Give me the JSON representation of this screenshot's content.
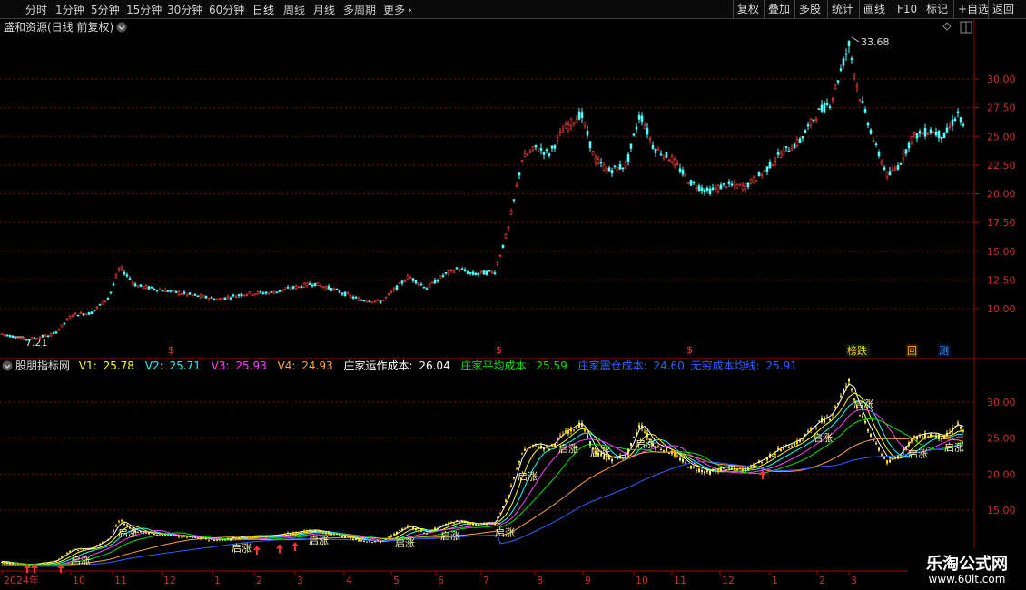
{
  "toolbar": {
    "periods": [
      "分时",
      "1分钟",
      "5分钟",
      "15分钟",
      "30分钟",
      "60分钟",
      "日线",
      "周线",
      "月线",
      "多周期",
      "更多"
    ],
    "active_period": "日线",
    "right_items": [
      "复权",
      "叠加",
      "多股",
      "统计",
      "画线",
      "F10",
      "标记",
      "+自选",
      "返回"
    ]
  },
  "main_panel": {
    "title": "盛和资源(日线 前复权)",
    "high_label": "33.68",
    "low_label": "7.21",
    "y_ticks": [
      "30.00",
      "27.50",
      "25.00",
      "22.50",
      "20.00",
      "17.50",
      "15.00",
      "12.50",
      "10.00"
    ],
    "tags": [
      "榜跌",
      "回",
      "测"
    ],
    "markers": [
      "$",
      "$",
      "$"
    ]
  },
  "indicator_panel": {
    "name": "股朋指标网",
    "fields": [
      {
        "label": "V1:",
        "value": "25.78",
        "color": "#ffff00"
      },
      {
        "label": "V2:",
        "value": "25.71",
        "color": "#00ffff"
      },
      {
        "label": "V3:",
        "value": "25.93",
        "color": "#ff40ff"
      },
      {
        "label": "V4:",
        "value": "24.93",
        "color": "#ffa040"
      },
      {
        "label": "庄家运作成本:",
        "value": "26.04",
        "color": "#ffffff"
      },
      {
        "label": "庄家平均成本:",
        "value": "25.59",
        "color": "#00e000"
      },
      {
        "label": "庄家震仓成本:",
        "value": "24.60",
        "color": "#3060ff"
      },
      {
        "label": "无穷成本均线:",
        "value": "25.91",
        "color": "#3060ff"
      }
    ],
    "y_ticks": [
      "30.00",
      "25.00",
      "20.00",
      "15.00"
    ],
    "signal_text": "启涨"
  },
  "x_axis": {
    "labels": [
      "2024年",
      "10",
      "11",
      "12",
      "1",
      "2",
      "3",
      "4",
      "5",
      "6",
      "7",
      "8",
      "9",
      "10",
      "11",
      "12",
      "1",
      "2",
      "3"
    ]
  },
  "watermark": {
    "line1": "乐淘公式网",
    "line2": "www.60lt.com"
  },
  "colors": {
    "up": "#ff4040",
    "down": "#54ffff",
    "grid": "#7a1010",
    "axis": "#b00000"
  },
  "icons": [
    "chevron-down-icon",
    "diamond-icon",
    "panel-toggle-icon",
    "chevron-right-icon"
  ]
}
